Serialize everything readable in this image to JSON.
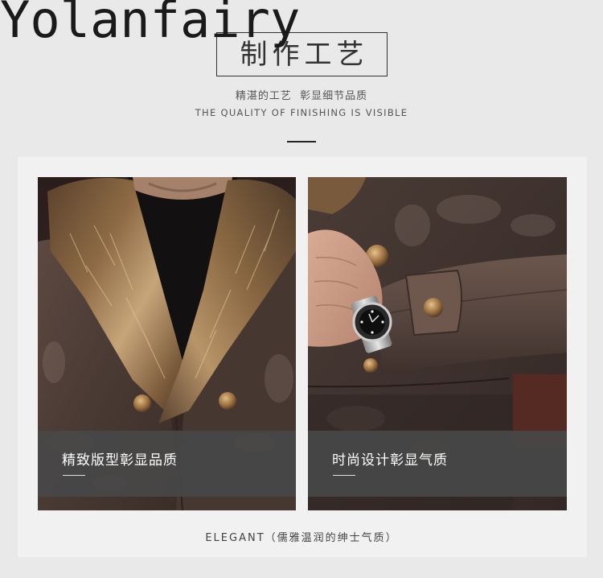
{
  "brand": {
    "logo_text": "Yolanfairy"
  },
  "section": {
    "title": "制作工艺",
    "subtitle_cn": "精湛的工艺  彰显细节品质",
    "subtitle_en": "THE QUALITY OF FINISHING IS VISIBLE"
  },
  "cards": [
    {
      "caption": "精致版型彰显品质"
    },
    {
      "caption": "时尚设计彰显气质"
    }
  ],
  "footer": {
    "text": "ELEGANT（儒雅温润的绅士气质）"
  },
  "colors": {
    "page_bg": "#e9e9e9",
    "panel_bg": "#f1f1f1",
    "text": "#333333",
    "caption_overlay": "#484848",
    "caption_text": "#ffffff"
  }
}
